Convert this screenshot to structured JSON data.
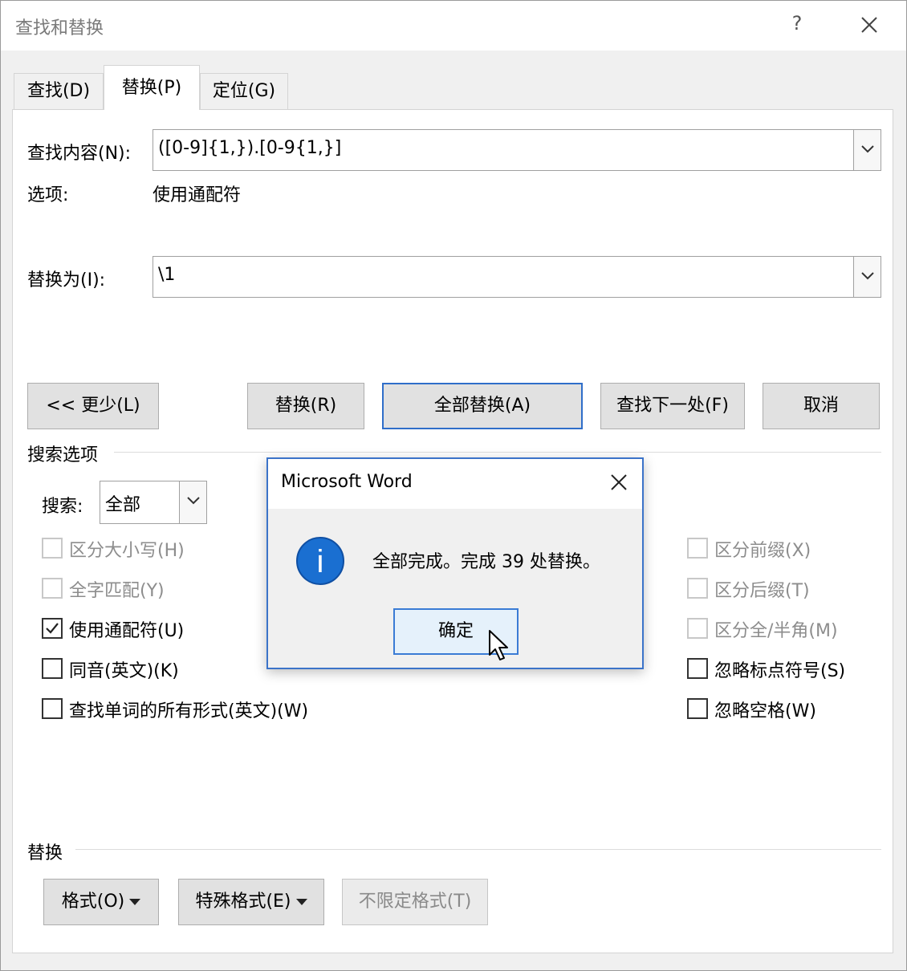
{
  "window": {
    "title": "查找和替换",
    "help_label": "?"
  },
  "tabs": [
    {
      "label": "查找(D)",
      "active": false
    },
    {
      "label": "替换(P)",
      "active": true
    },
    {
      "label": "定位(G)",
      "active": false
    }
  ],
  "find": {
    "label": "查找内容(N):",
    "value": "([0-9]{1,}).[0-9{1,}]",
    "options_label": "选项:",
    "options_value": "使用通配符"
  },
  "replace": {
    "label": "替换为(I):",
    "value": "\\1"
  },
  "buttons": {
    "less": "<< 更少(L)",
    "replace": "替换(R)",
    "replace_all": "全部替换(A)",
    "find_next": "查找下一处(F)",
    "cancel": "取消"
  },
  "search_options": {
    "header": "搜索选项",
    "search_label": "搜索:",
    "search_value": "全部",
    "left": [
      {
        "label": "区分大小写(H)",
        "checked": false,
        "enabled": false
      },
      {
        "label": "全字匹配(Y)",
        "checked": false,
        "enabled": false
      },
      {
        "label": "使用通配符(U)",
        "checked": true,
        "enabled": true
      },
      {
        "label": "同音(英文)(K)",
        "checked": false,
        "enabled": true
      },
      {
        "label": "查找单词的所有形式(英文)(W)",
        "checked": false,
        "enabled": true
      }
    ],
    "right": [
      {
        "label": "区分前缀(X)",
        "checked": false,
        "enabled": false
      },
      {
        "label": "区分后缀(T)",
        "checked": false,
        "enabled": false
      },
      {
        "label": "区分全/半角(M)",
        "checked": false,
        "enabled": false
      },
      {
        "label": "忽略标点符号(S)",
        "checked": false,
        "enabled": true
      },
      {
        "label": "忽略空格(W)",
        "checked": false,
        "enabled": true
      }
    ]
  },
  "replace_section": {
    "header": "替换",
    "format": "格式(O)",
    "special": "特殊格式(E)",
    "no_format": "不限定格式(T)"
  },
  "message_box": {
    "title": "Microsoft Word",
    "text": "全部完成。完成 39 处替换。",
    "icon_letter": "i",
    "ok": "确定"
  },
  "colors": {
    "accent": "#2f6ec9",
    "info_icon": "#1a6fd1"
  }
}
